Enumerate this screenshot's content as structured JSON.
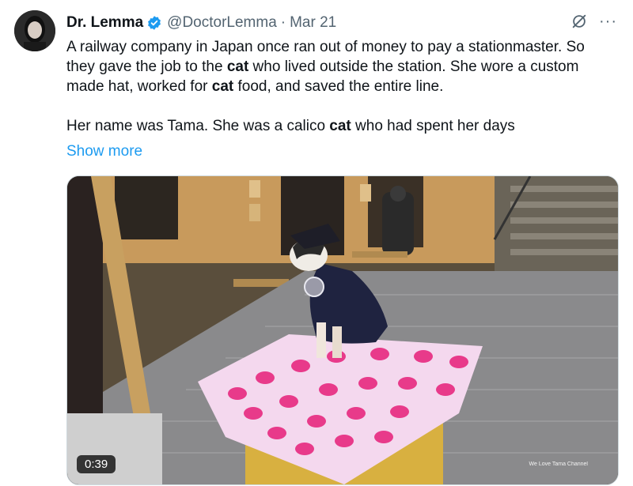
{
  "tweet": {
    "author_name": "Dr. Lemma",
    "handle": "@DoctorLemma",
    "separator": "·",
    "date": "Mar 21",
    "more_label": "···",
    "paragraph1_parts": [
      "A railway company in Japan once ran out of money to pay a stationmaster. So they gave the job to the ",
      "cat",
      " who lived outside the station. She wore a custom made hat, worked for ",
      "cat",
      " food, and saved the entire line."
    ],
    "paragraph2_parts": [
      "Her name was Tama. She was a calico ",
      "cat",
      " who had spent her days"
    ],
    "show_more": "Show more"
  },
  "video": {
    "duration": "0:39",
    "watermark": "We Love Tama Channel"
  },
  "colors": {
    "link": "#1d9bf0",
    "verified": "#1d9bf0",
    "secondary_text": "#536471"
  },
  "icons": {
    "verified": "verified-badge-icon",
    "grok": "grok-icon",
    "more": "more-options-icon"
  }
}
